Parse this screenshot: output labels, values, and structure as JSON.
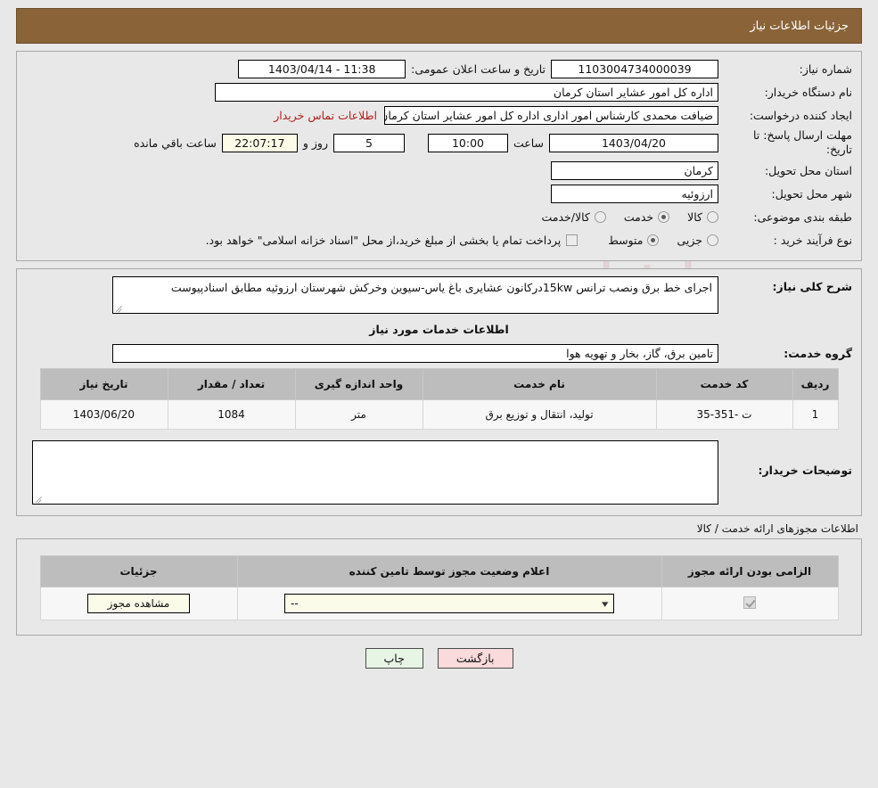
{
  "header": {
    "title": "جزئیات اطلاعات نیاز"
  },
  "form": {
    "need_number_label": "شماره نیاز:",
    "need_number_value": "1103004734000039",
    "announce_label": "تاریخ و ساعت اعلان عمومی:",
    "announce_value": "1403/04/14 - 11:38",
    "buyer_org_label": "نام دستگاه خریدار:",
    "buyer_org_value": "اداره کل امور عشایر استان کرمان",
    "creator_label": "ایجاد کننده درخواست:",
    "creator_value": "ضیافت محمدی کارشناس امور اداری اداره کل امور عشایر استان کرمان",
    "contact_link": "اطلاعات تماس خریدار",
    "deadline_label": "مهلت ارسال پاسخ: تا تاریخ:",
    "deadline_date": "1403/04/20",
    "deadline_time_label": "ساعت",
    "deadline_time": "10:00",
    "remaining_days": "5",
    "remaining_days_suffix": "روز و",
    "remaining_clock": "22:07:17",
    "remaining_suffix": "ساعت باقي مانده",
    "province_label": "استان محل تحویل:",
    "province_value": "کرمان",
    "city_label": "شهر محل تحویل:",
    "city_value": "ارزوئیه",
    "category_label": "طبقه بندی موضوعی:",
    "category_options": [
      {
        "label": "کالا",
        "selected": false
      },
      {
        "label": "خدمت",
        "selected": true
      },
      {
        "label": "کالا/خدمت",
        "selected": false
      }
    ],
    "process_label": "نوع فرآیند خرید :",
    "process_options": [
      {
        "label": "جزیی",
        "selected": false
      },
      {
        "label": "متوسط",
        "selected": true
      }
    ],
    "payment_checkbox_label": "پرداخت تمام یا بخشی از مبلغ خرید،از محل \"اسناد خزانه اسلامی\" خواهد بود.",
    "payment_checked": false
  },
  "description": {
    "label": "شرح کلی نیاز:",
    "value": "اجرای خط برق ونصب ترانس 15kwدرکانون عشایری باغ یاس-سیوین وخرکش شهرستان ارزوئیه مطابق اسنادپیوست"
  },
  "services": {
    "section_title": "اطلاعات خدمات مورد نیاز",
    "group_label": "گروه خدمت:",
    "group_value": "تامین برق، گاز، بخار و تهویه هوا",
    "columns": [
      "ردیف",
      "کد خدمت",
      "نام خدمت",
      "واحد اندازه گیری",
      "تعداد / مقدار",
      "تاریخ نیاز"
    ],
    "rows": [
      {
        "row": "1",
        "code": "ت -351-35",
        "name": "تولید، انتقال و توزیع برق",
        "unit": "متر",
        "qty": "1084",
        "need_date": "1403/06/20"
      }
    ]
  },
  "buyer_notes": {
    "label": "توضیحات خریدار:",
    "value": ""
  },
  "permits": {
    "section_title": "اطلاعات مجوزهای ارائه خدمت / کالا",
    "columns": [
      "الزامی بودن ارائه مجوز",
      "اعلام وضعیت مجوز توسط تامین کننده",
      "جزئیات"
    ],
    "rows": [
      {
        "required_checked": true,
        "status_value": "--",
        "details_button": "مشاهده مجوز"
      }
    ]
  },
  "footer": {
    "print_label": "چاپ",
    "back_label": "بازگشت"
  },
  "watermark": {
    "text": "AriaTender.net"
  },
  "colors": {
    "title_bar": "#8a6338",
    "link": "#b0211f",
    "back_button": "#fadadb",
    "print_button": "#e7f5e5",
    "highlight_field": "#fbfbe8"
  }
}
